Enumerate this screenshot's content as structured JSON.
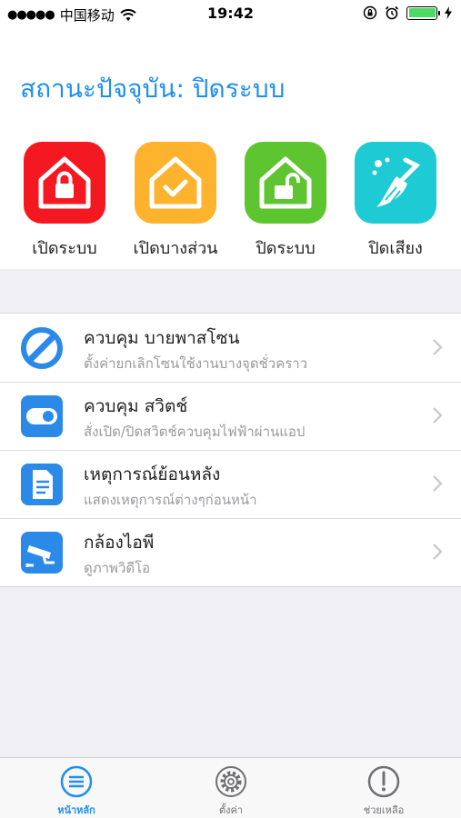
{
  "status_bar": {
    "signal": "●●●●●",
    "carrier": "中国移动",
    "time": "19:42"
  },
  "status_title": "สถานะปัจจุบัน: ปิดระบบ",
  "quick_actions": [
    {
      "label": "เปิดระบบ",
      "color": "#f41920",
      "icon": "house-lock-icon"
    },
    {
      "label": "เปิดบางส่วน",
      "color": "#fdb32d",
      "icon": "house-check-icon"
    },
    {
      "label": "ปิดระบบ",
      "color": "#5ec530",
      "icon": "house-unlock-icon"
    },
    {
      "label": "ปิดเสียง",
      "color": "#1ecad3",
      "icon": "broom-icon"
    }
  ],
  "menu": [
    {
      "title": "ควบคุม บายพาสโซน",
      "subtitle": "ตั้งค่ายกเลิกโซนใช้งานบางจุดชั่วคราว",
      "icon": "bypass-icon"
    },
    {
      "title": "ควบคุม สวิตช์",
      "subtitle": "สั่งเปิด/ปิดสวิตช์ควบคุมไฟฟ้าผ่านแอป",
      "icon": "toggle-switch-icon"
    },
    {
      "title": "เหตุการณ์ย้อนหลัง",
      "subtitle": "แสดงเหตุการณ์ต่างๆก่อนหน้า",
      "icon": "document-icon"
    },
    {
      "title": "กล้องไอพี",
      "subtitle": "ดูภาพวิดีโอ",
      "icon": "camera-icon"
    }
  ],
  "tabs": [
    {
      "label": "หน้าหลัก",
      "icon": "list-icon",
      "active": true
    },
    {
      "label": "ตั้งค่า",
      "icon": "gear-icon",
      "active": false
    },
    {
      "label": "ช่วยเหลือ",
      "icon": "exclamation-icon",
      "active": false
    }
  ],
  "colors": {
    "accent": "#1e8ff0",
    "icon_blue": "#2b8ae8"
  }
}
